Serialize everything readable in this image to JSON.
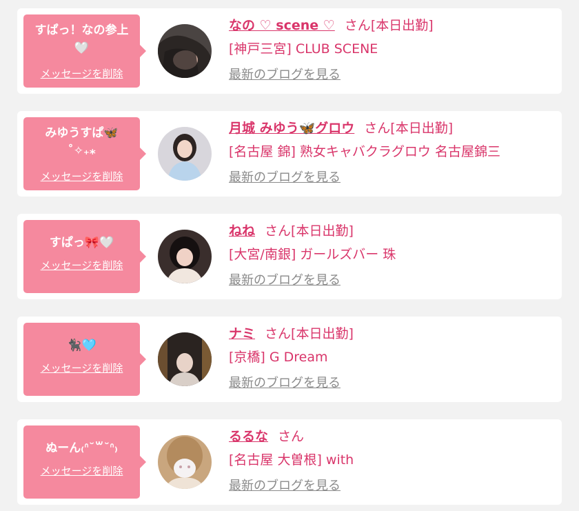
{
  "common": {
    "delete_label": "メッセージを削除",
    "blog_label": "最新のブログを見る",
    "san": "さん"
  },
  "colors": {
    "accent_pink": "#f5899e",
    "name_pink": "#d9356a",
    "link_gray": "#8a8a8a",
    "background": "#f2f2f2"
  },
  "items": [
    {
      "message": "すぱっ！なの参上\n🤍",
      "name": "なの ♡ scene ♡",
      "status": "[本日出勤]",
      "store": "[神戸三宮] CLUB SCENE"
    },
    {
      "message": "みゆうすぱ🦋\n˚✧₊⁎",
      "name": "月城 みゆう🦋グロウ",
      "status": "[本日出勤]",
      "store": "[名古屋 錦] 熟女キャバクラグロウ 名古屋錦三"
    },
    {
      "message": "すぱっ🎀🤍",
      "name": "ねね",
      "status": "[本日出勤]",
      "store": "[大宮/南銀] ガールズバー 珠"
    },
    {
      "message": "🐈‍⬛🩵",
      "name": "ナミ",
      "status": "[本日出勤]",
      "store": "[京橋] G Dream"
    },
    {
      "message": "ぬーん₍ᐢ˘꒳˘ᐢ₎",
      "name": "るるな",
      "status": "",
      "store": "[名古屋 大曽根] with"
    }
  ]
}
